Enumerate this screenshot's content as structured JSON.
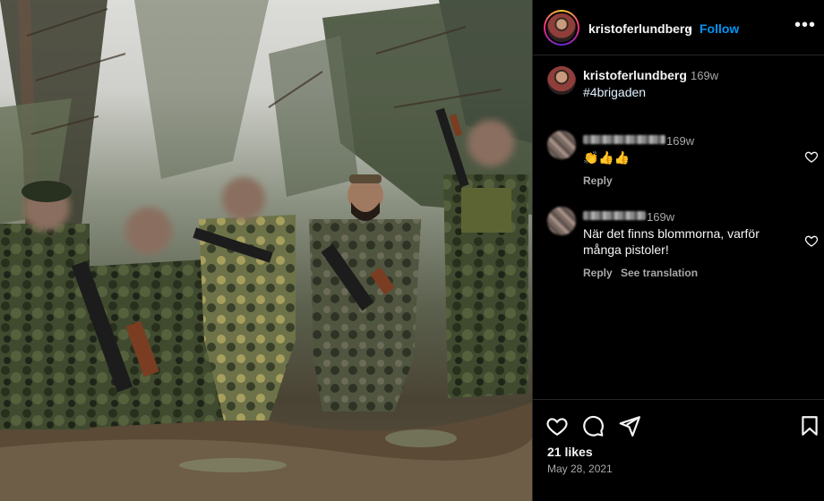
{
  "post": {
    "username": "kristoferlundberg",
    "separator": "•",
    "follow_label": "Follow",
    "more_label": "•••",
    "caption": {
      "username": "kristoferlundberg",
      "time": "169w",
      "text": "#4brigaden"
    },
    "comments": [
      {
        "time": "169w",
        "text": "👏👍👍",
        "reply_label": "Reply"
      },
      {
        "time": "169w",
        "text": "När det finns blommorna, varför många pistoler!",
        "reply_label": "Reply",
        "translate_label": "See translation"
      }
    ],
    "likes": "21 likes",
    "date": "May 28, 2021"
  },
  "icons": {
    "like": "heart-icon",
    "comment": "comment-icon",
    "share": "share-icon",
    "save": "bookmark-icon"
  },
  "colors": {
    "accent": "#0095f6",
    "background": "#000000",
    "secondary_text": "#a8a8a8"
  }
}
